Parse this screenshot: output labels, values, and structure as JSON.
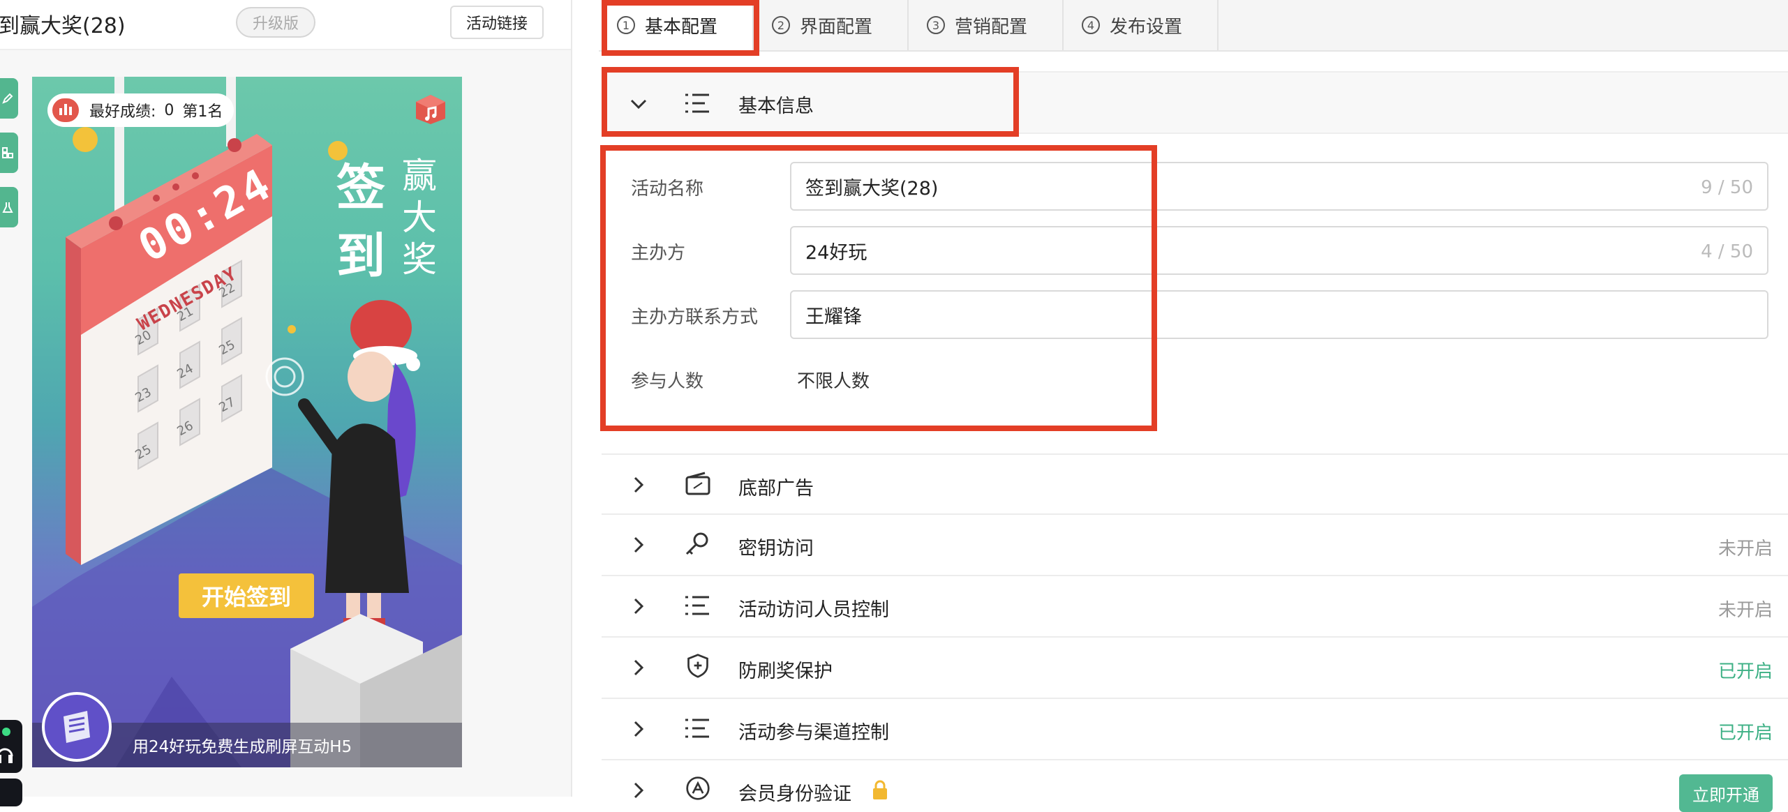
{
  "editor": {
    "title": "到赢大奖(28)",
    "upgrade_label": "升级版",
    "activity_link_label": "活动链接"
  },
  "preview": {
    "best_score_label": "最好成绩:",
    "best_score_value": "0",
    "rank_label": "第1名",
    "calendar_time": "00:24",
    "calendar_weekday": "WEDNESDAY",
    "calendar_days": [
      "20",
      "21",
      "22",
      "23",
      "24",
      "25",
      "25",
      "26",
      "27"
    ],
    "title_big": "签到",
    "title_small": "赢大奖",
    "start_button": "开始签到",
    "footer_text": "用24好玩免费生成刷屏互动H5"
  },
  "tabs": [
    {
      "num": "1",
      "label": "基本配置",
      "active": true
    },
    {
      "num": "2",
      "label": "界面配置",
      "active": false
    },
    {
      "num": "3",
      "label": "营销配置",
      "active": false
    },
    {
      "num": "4",
      "label": "发布设置",
      "active": false
    }
  ],
  "basic_info": {
    "header": "基本信息",
    "fields": {
      "activity_name": {
        "label": "活动名称",
        "value": "签到赢大奖(28)",
        "count": "9 / 50"
      },
      "organizer": {
        "label": "主办方",
        "value": "24好玩",
        "count": "4 / 50"
      },
      "contact": {
        "label": "主办方联系方式",
        "value": "王耀锋"
      },
      "participants": {
        "label": "参与人数",
        "value": "不限人数"
      }
    }
  },
  "sections": [
    {
      "label": "底部广告",
      "icon": "card-icon",
      "status": ""
    },
    {
      "label": "密钥访问",
      "icon": "key-icon",
      "status": "未开启"
    },
    {
      "label": "活动访问人员控制",
      "icon": "list-icon",
      "status": "未开启"
    },
    {
      "label": "防刷奖保护",
      "icon": "shield-icon",
      "status": "已开启"
    },
    {
      "label": "活动参与渠道控制",
      "icon": "list-icon",
      "status": "已开启"
    },
    {
      "label": "会员身份验证",
      "icon": "app-store-icon",
      "status": "",
      "button": "立即开通"
    }
  ],
  "colors": {
    "accent_green": "#3db085",
    "highlight_red": "#e33e26",
    "start_button_yellow": "#f4c13b"
  }
}
